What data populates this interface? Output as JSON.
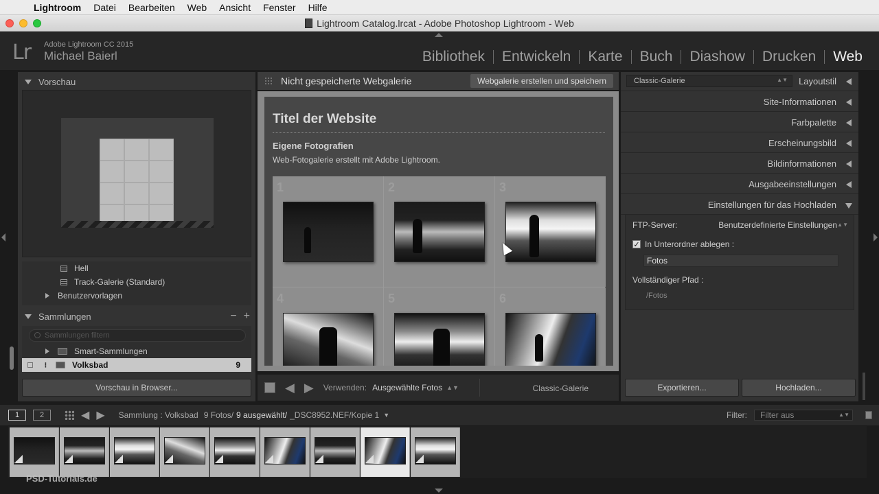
{
  "menubar": {
    "items": [
      "Lightroom",
      "Datei",
      "Bearbeiten",
      "Web",
      "Ansicht",
      "Fenster",
      "Hilfe"
    ]
  },
  "window": {
    "title": "Lightroom Catalog.lrcat - Adobe Photoshop Lightroom - Web"
  },
  "identity": {
    "logo": "Lr",
    "product": "Adobe Lightroom CC 2015",
    "user": "Michael Baierl"
  },
  "modules": [
    "Bibliothek",
    "Entwickeln",
    "Karte",
    "Buch",
    "Diashow",
    "Drucken",
    "Web"
  ],
  "left": {
    "preview_header": "Vorschau",
    "templates": [
      "Hell",
      "Track-Galerie (Standard)",
      "Benutzervorlagen"
    ],
    "collections_header": "Sammlungen",
    "collections_search_placeholder": "Sammlungen filtern",
    "collections": [
      {
        "name": "Smart-Sammlungen",
        "count": ""
      },
      {
        "name": "Volksbad",
        "count": "9"
      }
    ],
    "preview_button": "Vorschau in Browser..."
  },
  "center": {
    "title": "Nicht gespeicherte Webgalerie",
    "save_button": "Webgalerie erstellen und speichern",
    "site": {
      "title": "Titel der Website",
      "subtitle": "Eigene Fotografien",
      "description": "Web-Fotogalerie erstellt mit Adobe Lightroom."
    },
    "cell_numbers": [
      "1",
      "2",
      "3",
      "4",
      "5",
      "6"
    ],
    "bottom": {
      "use_label": "Verwenden:",
      "use_value": "Ausgewählte Fotos",
      "template": "Classic-Galerie"
    }
  },
  "right": {
    "layout_select": "Classic-Galerie",
    "sections": [
      "Layoutstil",
      "Site-Informationen",
      "Farbpalette",
      "Erscheinungsbild",
      "Bildinformationen",
      "Ausgabeeinstellungen",
      "Einstellungen für das Hochladen"
    ],
    "upload": {
      "ftp_label": "FTP-Server:",
      "ftp_value": "Benutzerdefinierte Einstellungen",
      "subfolder_label": "In Unterordner ablegen :",
      "subfolder_value": "Fotos",
      "path_label": "Vollständiger Pfad :",
      "path_value": "/Fotos"
    },
    "export_button": "Exportieren...",
    "upload_button": "Hochladen..."
  },
  "filmbar": {
    "monitor1": "1",
    "monitor2": "2",
    "source_label": "Sammlung : Volksbad",
    "count": "9 Fotos/",
    "selected": "9 ausgewählt/",
    "file": "_DSC8952.NEF/Kopie 1",
    "filter_label": "Filter:",
    "filter_value": "Filter aus"
  },
  "watermark": "PSD-Tutorials.de",
  "colors": {
    "panel": "#333333",
    "active_module": "#f0f0f0",
    "selected_row": "#c8c8c8"
  }
}
